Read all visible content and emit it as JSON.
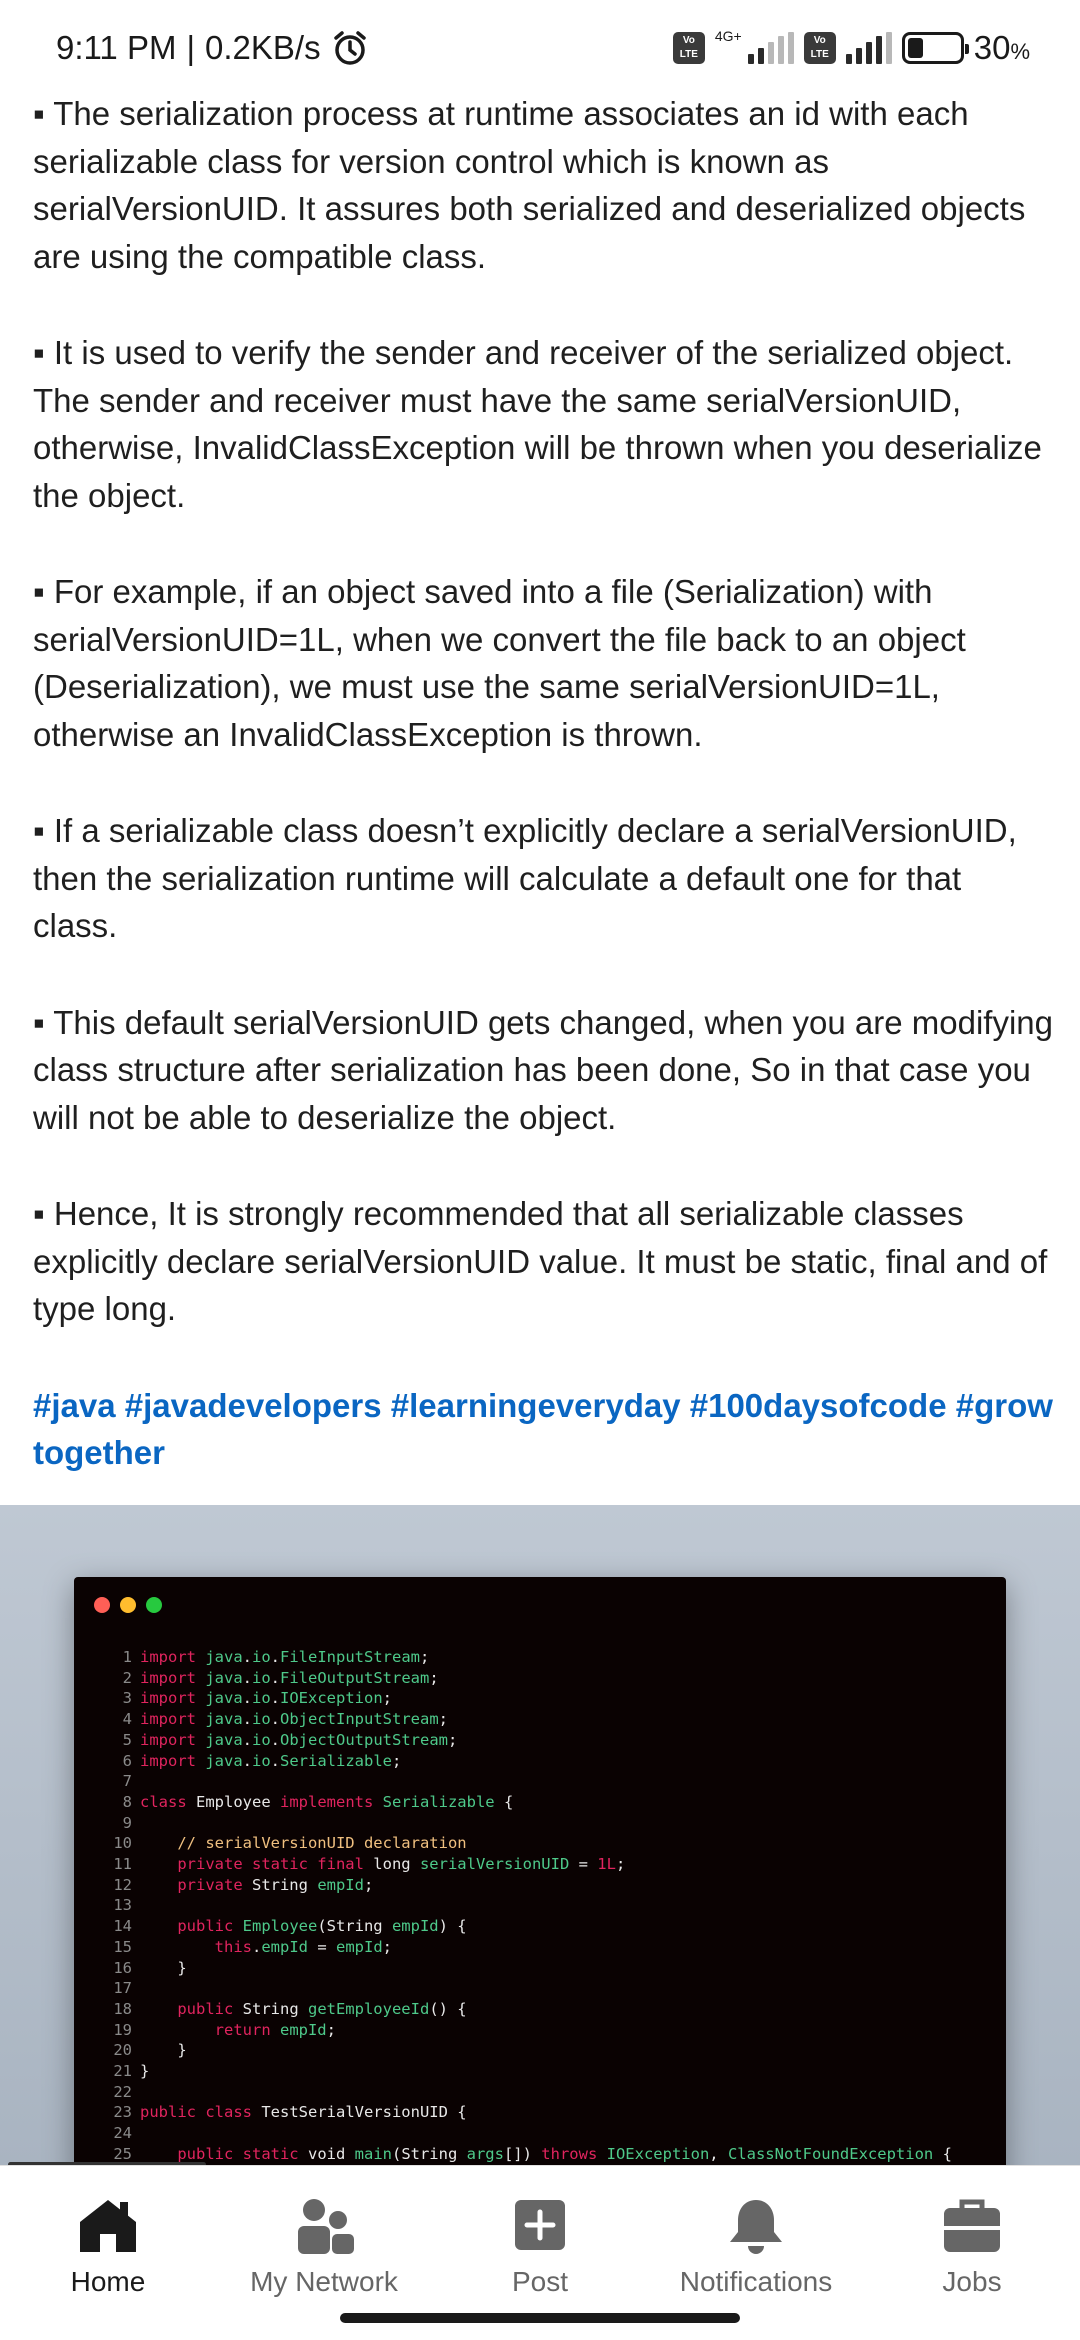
{
  "status": {
    "time": "9:11 PM",
    "speed": "0.2KB/s",
    "volte": "Vo LTE",
    "network": "4G+",
    "battery_percent": "30",
    "battery_unit": "%"
  },
  "post": {
    "paragraphs": [
      "▪ The serialization process at runtime associates an id with each serializable class for version control which is known as serialVersionUID. It assures both serialized and deserialized objects are using the compatible class.",
      "▪ It is used to verify the sender and receiver of the serialized object. The sender and receiver must have the same serialVersionUID, otherwise, InvalidClassException will be thrown when you deserialize the object.",
      "▪ For example, if an object saved into a file (Serialization) with serialVersionUID=1L, when we convert the file back to an object (Deserialization), we must use the same serialVersionUID=1L, otherwise an InvalidClassException is thrown.",
      "▪ If a serializable class doesn’t explicitly declare a serialVersionUID, then the serialization runtime will calculate a default one for that class.",
      "▪ This default serialVersionUID gets changed, when you are modifying class structure after serialization has been done, So in that case you will not be able to deserialize the object.",
      "▪ Hence, It is strongly recommended that all serializable classes explicitly declare serialVersionUID value. It must be static, final and of type long."
    ],
    "hashtags": "#java #javadevelopers #learningeveryday #100daysofcode #growtogether"
  },
  "code_lines": [
    {
      "n": "1",
      "segs": [
        [
          "kw",
          "import "
        ],
        [
          "pk",
          "java"
        ],
        [
          "",
          "."
        ],
        [
          "pk",
          "io"
        ],
        [
          "",
          "."
        ],
        [
          "pk",
          "FileInputStream"
        ],
        [
          "",
          ";"
        ]
      ]
    },
    {
      "n": "2",
      "segs": [
        [
          "kw",
          "import "
        ],
        [
          "pk",
          "java"
        ],
        [
          "",
          "."
        ],
        [
          "pk",
          "io"
        ],
        [
          "",
          "."
        ],
        [
          "pk",
          "FileOutputStream"
        ],
        [
          "",
          ";"
        ]
      ]
    },
    {
      "n": "3",
      "segs": [
        [
          "kw",
          "import "
        ],
        [
          "pk",
          "java"
        ],
        [
          "",
          "."
        ],
        [
          "pk",
          "io"
        ],
        [
          "",
          "."
        ],
        [
          "pk",
          "IOException"
        ],
        [
          "",
          ";"
        ]
      ]
    },
    {
      "n": "4",
      "segs": [
        [
          "kw",
          "import "
        ],
        [
          "pk",
          "java"
        ],
        [
          "",
          "."
        ],
        [
          "pk",
          "io"
        ],
        [
          "",
          "."
        ],
        [
          "pk",
          "ObjectInputStream"
        ],
        [
          "",
          ";"
        ]
      ]
    },
    {
      "n": "5",
      "segs": [
        [
          "kw",
          "import "
        ],
        [
          "pk",
          "java"
        ],
        [
          "",
          "."
        ],
        [
          "pk",
          "io"
        ],
        [
          "",
          "."
        ],
        [
          "pk",
          "ObjectOutputStream"
        ],
        [
          "",
          ";"
        ]
      ]
    },
    {
      "n": "6",
      "segs": [
        [
          "kw",
          "import "
        ],
        [
          "pk",
          "java"
        ],
        [
          "",
          "."
        ],
        [
          "pk",
          "io"
        ],
        [
          "",
          "."
        ],
        [
          "pk",
          "Serializable"
        ],
        [
          "",
          ";"
        ]
      ]
    },
    {
      "n": "7",
      "segs": []
    },
    {
      "n": "8",
      "segs": [
        [
          "kw",
          "class "
        ],
        [
          "",
          "Employee "
        ],
        [
          "kw",
          "implements "
        ],
        [
          "pk",
          "Serializable "
        ],
        [
          "",
          "{"
        ]
      ]
    },
    {
      "n": "9",
      "segs": []
    },
    {
      "n": "10",
      "segs": [
        [
          "",
          "    "
        ],
        [
          "cm",
          "// serialVersionUID declaration"
        ]
      ]
    },
    {
      "n": "11",
      "segs": [
        [
          "",
          "    "
        ],
        [
          "kw",
          "private static final "
        ],
        [
          "",
          "long "
        ],
        [
          "pk",
          "serialVersionUID"
        ],
        [
          "",
          " = "
        ],
        [
          "nm",
          "1L"
        ],
        [
          "",
          ";"
        ]
      ]
    },
    {
      "n": "12",
      "segs": [
        [
          "",
          "    "
        ],
        [
          "kw",
          "private "
        ],
        [
          "",
          "String "
        ],
        [
          "pk",
          "empId"
        ],
        [
          "",
          ";"
        ]
      ]
    },
    {
      "n": "13",
      "segs": []
    },
    {
      "n": "14",
      "segs": [
        [
          "",
          "    "
        ],
        [
          "kw",
          "public "
        ],
        [
          "pk",
          "Employee"
        ],
        [
          "",
          "(String "
        ],
        [
          "pk",
          "empId"
        ],
        [
          "",
          ") {"
        ]
      ]
    },
    {
      "n": "15",
      "segs": [
        [
          "",
          "        "
        ],
        [
          "kw",
          "this"
        ],
        [
          "",
          "."
        ],
        [
          "pk",
          "empId"
        ],
        [
          "",
          " = "
        ],
        [
          "pk",
          "empId"
        ],
        [
          "",
          ";"
        ]
      ]
    },
    {
      "n": "16",
      "segs": [
        [
          "",
          "    }"
        ]
      ]
    },
    {
      "n": "17",
      "segs": []
    },
    {
      "n": "18",
      "segs": [
        [
          "",
          "    "
        ],
        [
          "kw",
          "public "
        ],
        [
          "",
          "String "
        ],
        [
          "pk",
          "getEmployeeId"
        ],
        [
          "",
          "() {"
        ]
      ]
    },
    {
      "n": "19",
      "segs": [
        [
          "",
          "        "
        ],
        [
          "kw",
          "return "
        ],
        [
          "pk",
          "empId"
        ],
        [
          "",
          ";"
        ]
      ]
    },
    {
      "n": "20",
      "segs": [
        [
          "",
          "    }"
        ]
      ]
    },
    {
      "n": "21",
      "segs": [
        [
          "",
          "}"
        ]
      ]
    },
    {
      "n": "22",
      "segs": []
    },
    {
      "n": "23",
      "segs": [
        [
          "kw",
          "public class "
        ],
        [
          "",
          "TestSerialVersionUID {"
        ]
      ]
    },
    {
      "n": "24",
      "segs": []
    },
    {
      "n": "25",
      "segs": [
        [
          "",
          "    "
        ],
        [
          "kw",
          "public static "
        ],
        [
          "",
          "void "
        ],
        [
          "pk",
          "main"
        ],
        [
          "",
          "(String "
        ],
        [
          "pk",
          "args"
        ],
        [
          "",
          "[]) "
        ],
        [
          "kw",
          "throws "
        ],
        [
          "pk",
          "IOException"
        ],
        [
          "",
          ", "
        ],
        [
          "pk",
          "ClassNotFoundException"
        ],
        [
          "",
          " {"
        ]
      ]
    }
  ],
  "window_dots": [
    "#ff5f56",
    "#ffbd2e",
    "#27c93f"
  ],
  "nav": {
    "items": [
      {
        "label": "Home",
        "icon": "home-icon"
      },
      {
        "label": "My Network",
        "icon": "network-icon"
      },
      {
        "label": "Post",
        "icon": "post-plus-icon"
      },
      {
        "label": "Notifications",
        "icon": "bell-icon"
      },
      {
        "label": "Jobs",
        "icon": "briefcase-icon"
      }
    ]
  },
  "colors": {
    "hashtag": "#0a66c2",
    "nav_active": "#1a1a1a",
    "nav_inactive": "#666666"
  }
}
